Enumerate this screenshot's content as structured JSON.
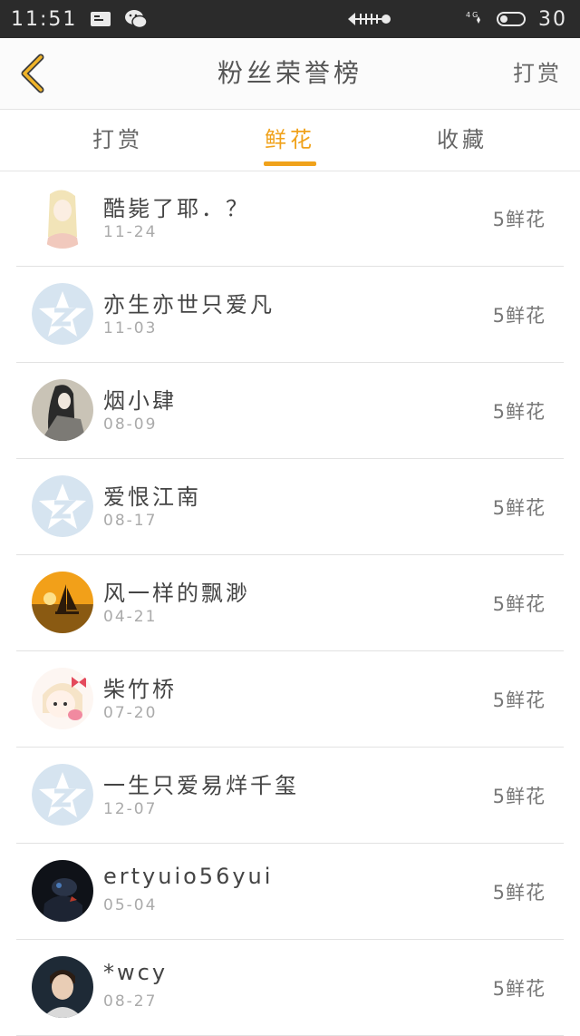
{
  "status_bar": {
    "time": "11:51",
    "battery": "30"
  },
  "header": {
    "title": "粉丝荣誉榜",
    "action": "打赏"
  },
  "tabs": [
    {
      "label": "打赏"
    },
    {
      "label": "鲜花"
    },
    {
      "label": "收藏"
    }
  ],
  "active_tab": "鲜花",
  "colors": {
    "accent": "#f0a21b",
    "status_bar": "#2b2b2b"
  },
  "fans": [
    {
      "name": "酷毙了耶．？",
      "date": "11-24",
      "amount": "5鲜花",
      "avatar": "anime-girl-avatar"
    },
    {
      "name": "亦生亦世只爱凡",
      "date": "11-03",
      "amount": "5鲜花",
      "avatar": "default-avatar"
    },
    {
      "name": "烟小肆",
      "date": "08-09",
      "amount": "5鲜花",
      "avatar": "ink-painting-avatar"
    },
    {
      "name": "爱恨江南",
      "date": "08-17",
      "amount": "5鲜花",
      "avatar": "default-avatar"
    },
    {
      "name": "风一样的飘渺",
      "date": "04-21",
      "amount": "5鲜花",
      "avatar": "sunset-boat-avatar"
    },
    {
      "name": "柴竹桥",
      "date": "07-20",
      "amount": "5鲜花",
      "avatar": "cartoon-girl-avatar"
    },
    {
      "name": "一生只爱易烊千玺",
      "date": "12-07",
      "amount": "5鲜花",
      "avatar": "default-avatar"
    },
    {
      "name": "ertyuio56yui",
      "date": "05-04",
      "amount": "5鲜花",
      "avatar": "dark-scene-avatar"
    },
    {
      "name": "*wcy",
      "date": "08-27",
      "amount": "5鲜花",
      "avatar": "portrait-avatar"
    }
  ]
}
